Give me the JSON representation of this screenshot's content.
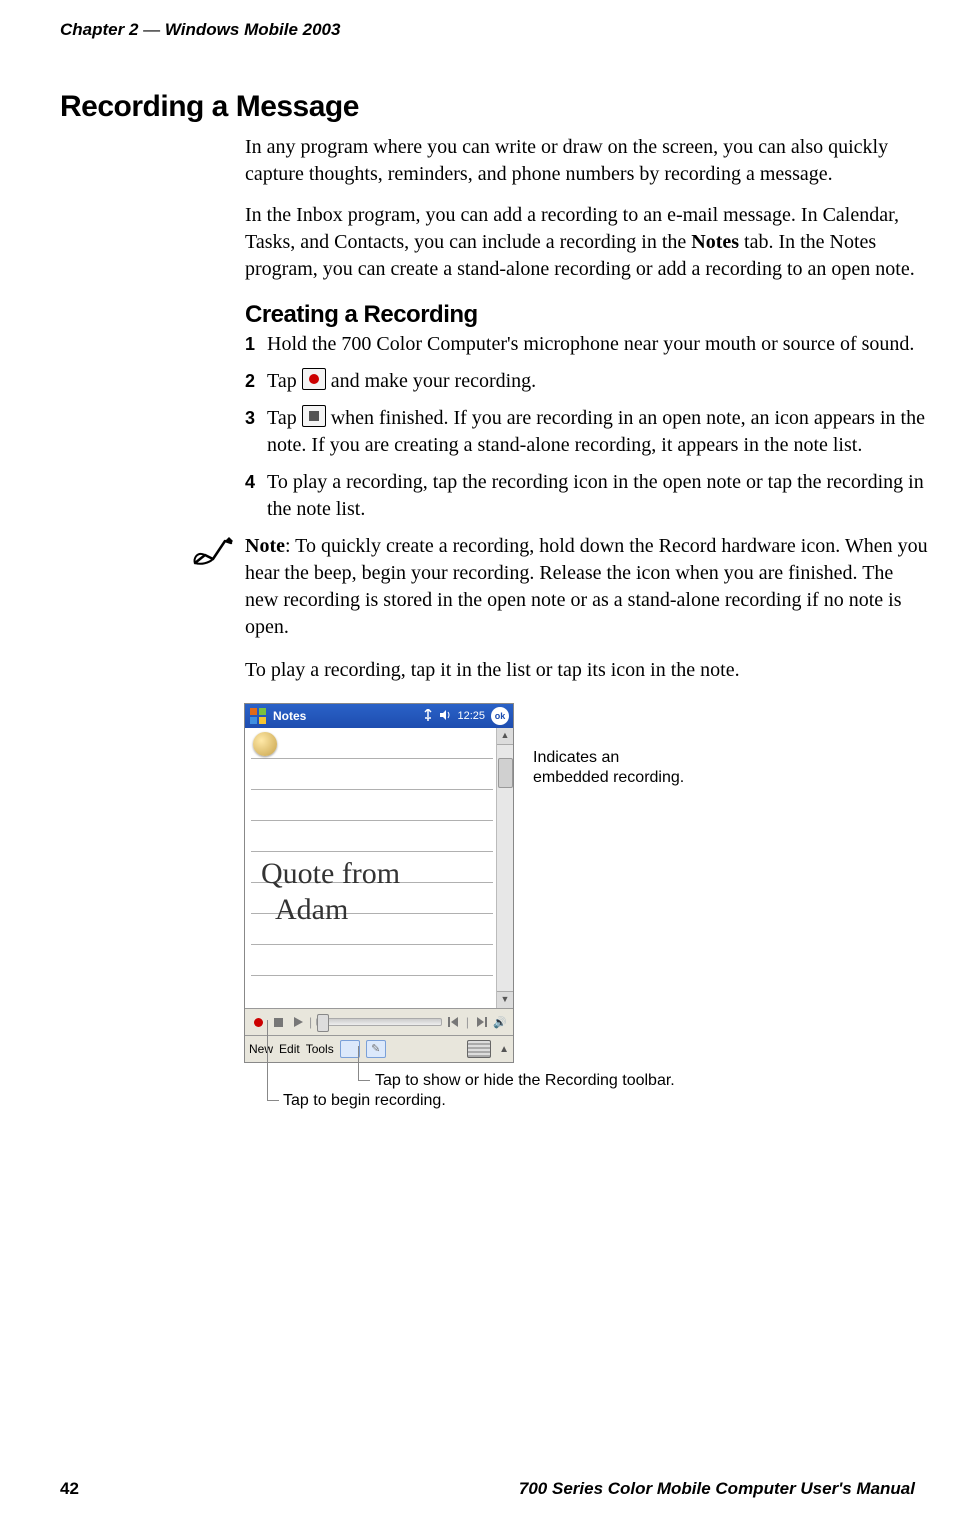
{
  "running_header": {
    "chapter": "Chapter 2",
    "sep": "—",
    "title": "Windows Mobile 2003"
  },
  "h1": "Recording a Message",
  "p1": "In any program where you can write or draw on the screen, you can also quickly capture thoughts, reminders, and phone numbers by recording a message.",
  "p2_a": "In the Inbox program, you can add a recording to an e-mail message. In Calendar, Tasks, and Contacts, you can include a recording in the ",
  "p2_bold": "Notes",
  "p2_b": " tab. In the Notes program, you can create a stand-alone recording or add a recording to an open note.",
  "h2": "Creating a Recording",
  "steps": {
    "1": "Hold the 700 Color Computer's microphone near your mouth or source of sound.",
    "2a": "Tap ",
    "2b": " and make your recording.",
    "3a": "Tap ",
    "3b": " when finished. If you are recording in an open note, an icon appears in the note. If you are creating a stand-alone recording, it appears in the note list.",
    "4": "To play a recording, tap the recording icon in the open note or tap the recording in the note list."
  },
  "note_label": "Note",
  "note_body": ": To quickly create a recording, hold down the Record hardware icon. When you hear the beep, begin your recording. Release the icon when you are finished. The new recording is stored in the open note or as a stand-alone recording if no note is open.",
  "p3": "To play a recording, tap it in the list or tap its icon in the note.",
  "device": {
    "app_title": "Notes",
    "time": "12:25",
    "ok": "ok",
    "handwriting_l1": "Quote from",
    "handwriting_l2": "Adam",
    "menu": {
      "new": "New",
      "edit": "Edit",
      "tools": "Tools"
    }
  },
  "annotations": {
    "embedded": "Indicates an embedded recording.",
    "toolbar": "Tap to show or hide the Recording toolbar.",
    "begin": "Tap to begin recording."
  },
  "footer": {
    "page": "42",
    "title": "700 Series Color Mobile Computer User's Manual"
  }
}
